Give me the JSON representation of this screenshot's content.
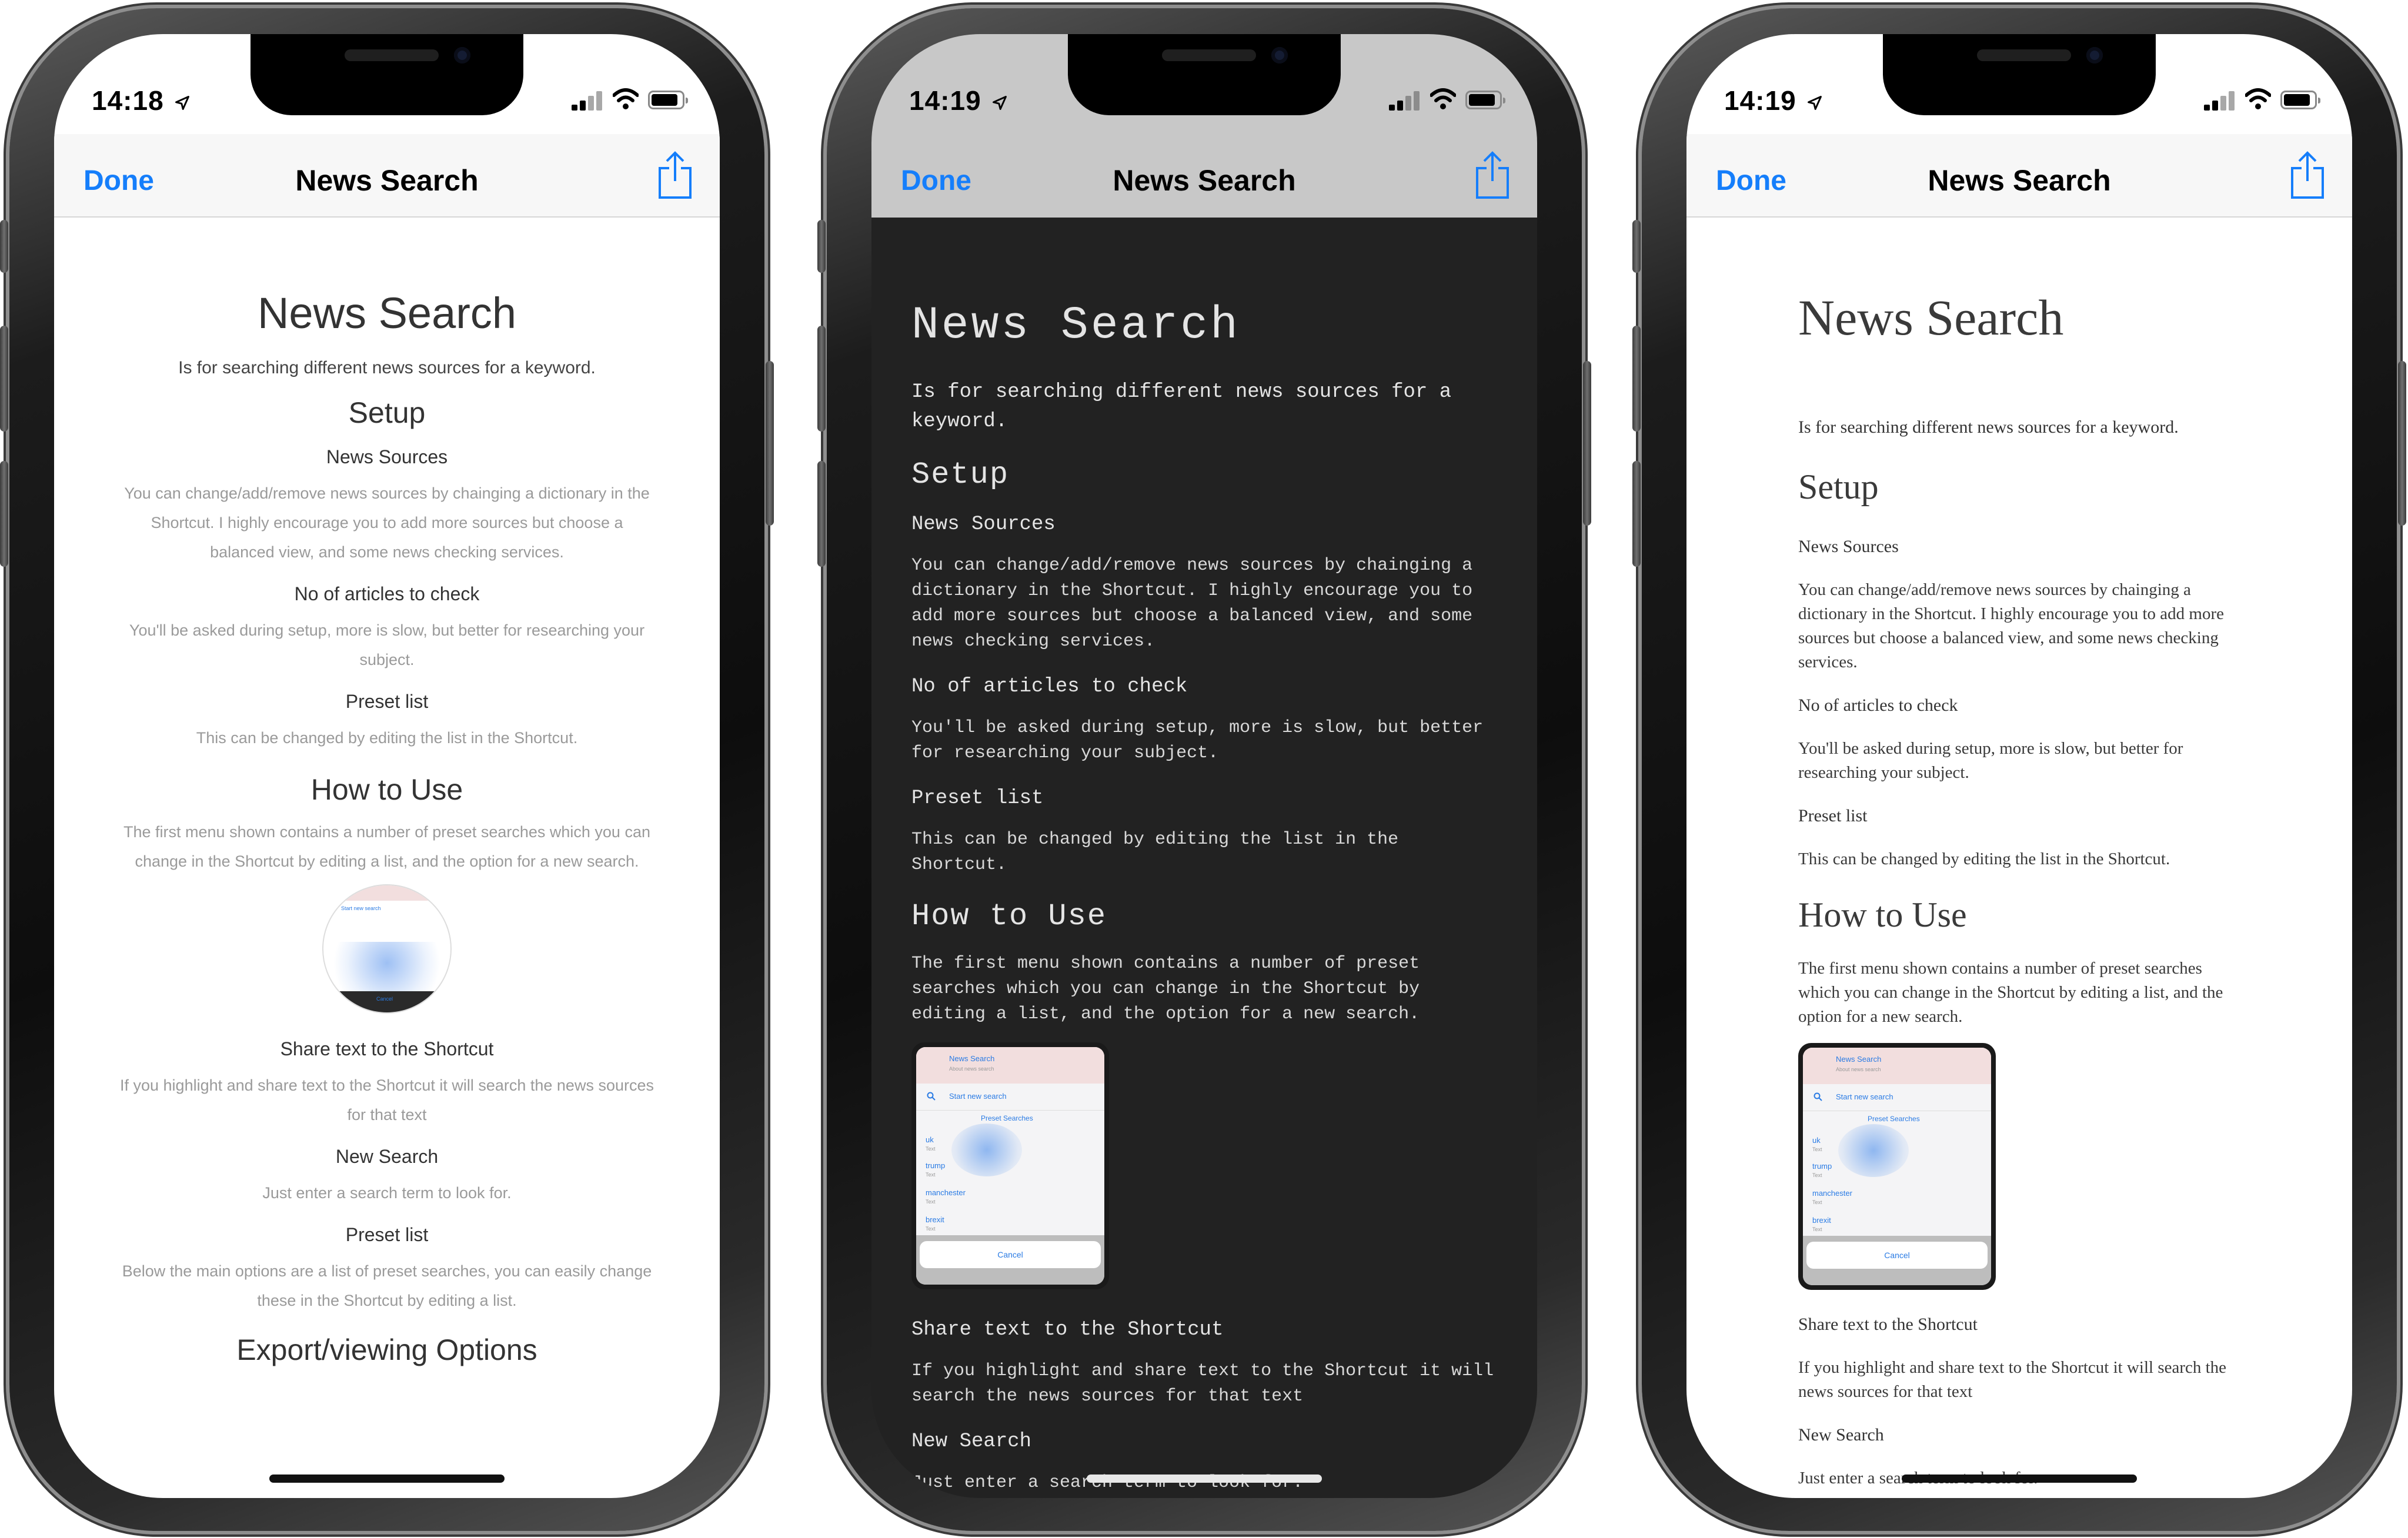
{
  "phones": [
    {
      "theme": "light-sans",
      "status": {
        "time": "14:18"
      },
      "nav": {
        "done": "Done",
        "title": "News Search"
      },
      "doc": {
        "title": "News Search",
        "intro": "Is for searching different news sources for a keyword.",
        "setup": "Setup",
        "news_sources": "News Sources",
        "news_sources_body": "You can change/add/remove news sources by chainging a dictionary in the Shortcut. I highly encourage you to add more sources but choose a balanced view, and some news checking services.",
        "articles": "No of articles to check",
        "articles_body": "You'll be asked during setup, more is slow, but better for researching your subject.",
        "preset": "Preset list",
        "preset_body": "This can be changed by editing the list in the Shortcut.",
        "how": "How to Use",
        "how_body": "The first menu shown contains a number of preset searches which you can change in the Shortcut by editing a list, and the option for a new search.",
        "share": "Share text to the Shortcut",
        "share_body": "If you highlight and share text to the Shortcut it will search the news sources for that text",
        "new_search": "New Search",
        "new_search_body": "Just enter a search term to look for.",
        "preset2": "Preset list",
        "preset2_body": "Below the main options are a list of preset searches, you can easily change these in the Shortcut by editing a list.",
        "export": "Export/viewing Options"
      }
    },
    {
      "theme": "dark-mono",
      "status": {
        "time": "14:19"
      },
      "nav": {
        "done": "Done",
        "title": "News Search"
      },
      "doc": {
        "title": "News Search",
        "intro": "Is for searching different news sources for a keyword.",
        "setup": "Setup",
        "news_sources": "News Sources",
        "news_sources_body": "You can change/add/remove news sources by chainging a dictionary in the Shortcut. I highly encourage you to add more sources but choose a balanced view, and some news checking services.",
        "articles": "No of articles to check",
        "articles_body": "You'll be asked during setup, more is slow, but better for researching your subject.",
        "preset": "Preset list",
        "preset_body": "This can be changed by editing the list in the Shortcut.",
        "how": "How to Use",
        "how_body": "The first menu shown contains a number of preset searches which you can change in the Shortcut by editing a list, and the option for a new search.",
        "share": "Share text to the Shortcut",
        "share_body": "If you highlight and share text to the Shortcut it will search the news sources for that text",
        "new_search": "New Search",
        "new_search_body": "Just enter a search term to look for."
      }
    },
    {
      "theme": "light-serif",
      "status": {
        "time": "14:19"
      },
      "nav": {
        "done": "Done",
        "title": "News Search"
      },
      "doc": {
        "title": "News Search",
        "intro": "Is for searching different news sources for a keyword.",
        "setup": "Setup",
        "news_sources": "News Sources",
        "news_sources_body": "You can change/add/remove news sources by chainging a dictionary in the Shortcut. I highly encourage you to add more sources but choose a balanced view, and some news checking services.",
        "articles": "No of articles to check",
        "articles_body": "You'll be asked during setup, more is slow, but better for researching your subject.",
        "preset": "Preset list",
        "preset_body": "This can be changed by editing the list in the Shortcut.",
        "how": "How to Use",
        "how_body": "The first menu shown contains a number of preset searches which you can change in the Shortcut by editing a list, and the option for a new search.",
        "share": "Share text to the Shortcut",
        "share_body": "If you highlight and share text to the Shortcut it will search the news sources for that text",
        "new_search": "New Search",
        "new_search_body": "Just enter a search term to look for."
      }
    }
  ],
  "mini_screenshot": {
    "title": "News Search",
    "subtitle": "About news search",
    "start": "Start new search",
    "section": "Preset Searches",
    "items": [
      "uk",
      "trump",
      "manchester",
      "brexit"
    ],
    "item_sub": "Text",
    "cancel": "Cancel"
  },
  "colors": {
    "accent": "#157efb",
    "dark_bg": "#222222",
    "dark_nav": "#c8c8c8",
    "light_nav": "#f7f7f7"
  },
  "icons": [
    "location-arrow-icon",
    "cellular-signal-icon",
    "wifi-icon",
    "battery-icon",
    "share-icon",
    "search-icon"
  ]
}
